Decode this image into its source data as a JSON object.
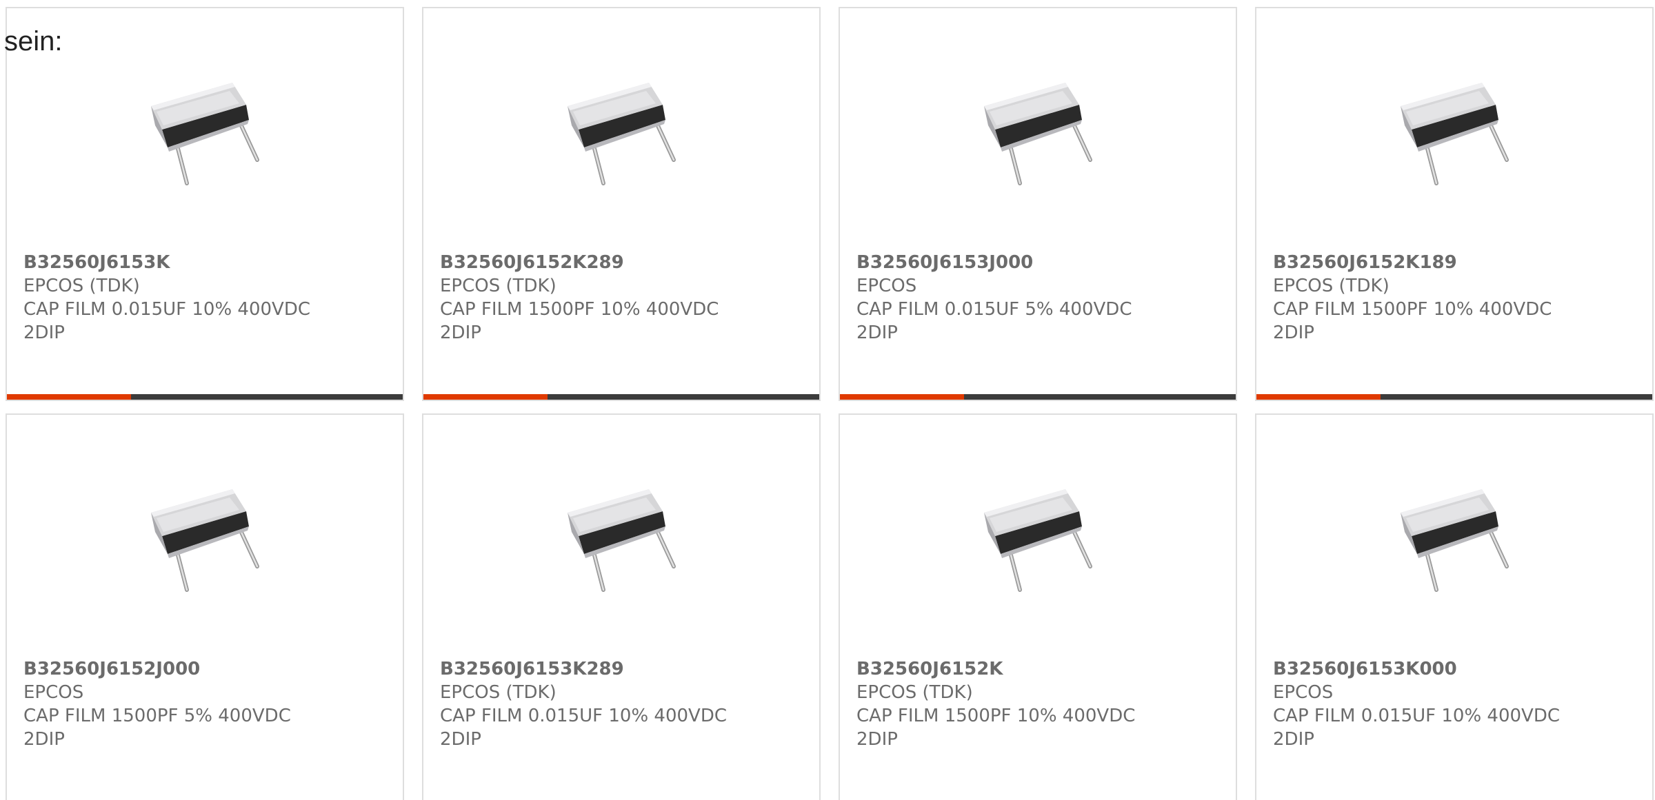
{
  "intro_text": "sein:",
  "colors": {
    "card_border": "#dedede",
    "text": "#6b6b6b",
    "bar_dark": "#3c3c3c",
    "bar_accent": "#e03a00"
  },
  "products": [
    {
      "part_number": "B32560J6153K",
      "manufacturer": "EPCOS (TDK)",
      "description": "CAP FILM 0.015UF 10% 400VDC",
      "package": "2DIP",
      "image_icon": "capacitor-image"
    },
    {
      "part_number": "B32560J6152K289",
      "manufacturer": "EPCOS (TDK)",
      "description": "CAP FILM 1500PF 10% 400VDC",
      "package": "2DIP",
      "image_icon": "capacitor-image"
    },
    {
      "part_number": "B32560J6153J000",
      "manufacturer": "EPCOS",
      "description": "CAP FILM 0.015UF 5% 400VDC",
      "package": "2DIP",
      "image_icon": "capacitor-image"
    },
    {
      "part_number": "B32560J6152K189",
      "manufacturer": "EPCOS (TDK)",
      "description": "CAP FILM 1500PF 10% 400VDC",
      "package": "2DIP",
      "image_icon": "capacitor-image"
    },
    {
      "part_number": "B32560J6152J000",
      "manufacturer": "EPCOS",
      "description": "CAP FILM 1500PF 5% 400VDC",
      "package": "2DIP",
      "image_icon": "capacitor-image"
    },
    {
      "part_number": "B32560J6153K289",
      "manufacturer": "EPCOS (TDK)",
      "description": "CAP FILM 0.015UF 10% 400VDC",
      "package": "2DIP",
      "image_icon": "capacitor-image"
    },
    {
      "part_number": "B32560J6152K",
      "manufacturer": "EPCOS (TDK)",
      "description": "CAP FILM 1500PF 10% 400VDC",
      "package": "2DIP",
      "image_icon": "capacitor-image"
    },
    {
      "part_number": "B32560J6153K000",
      "manufacturer": "EPCOS",
      "description": "CAP FILM 0.015UF 10% 400VDC",
      "package": "2DIP",
      "image_icon": "capacitor-image"
    }
  ]
}
